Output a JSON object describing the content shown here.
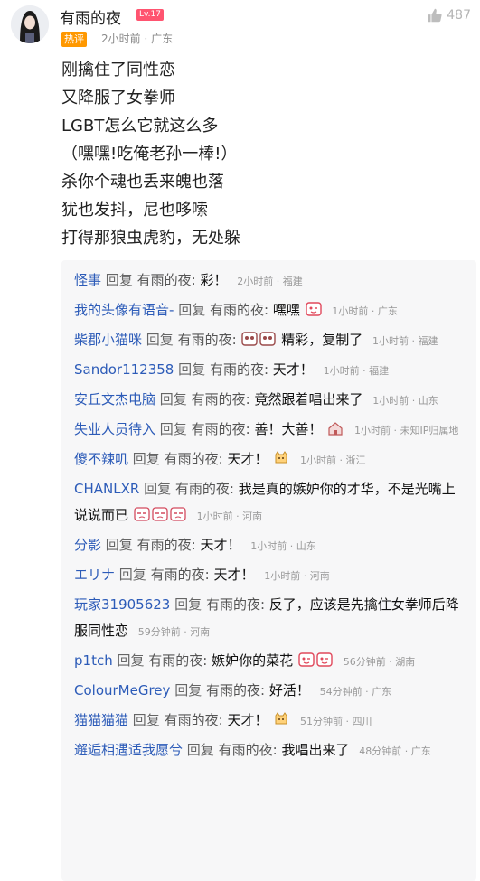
{
  "comment": {
    "username": "有雨的夜",
    "level_badge": "Lv.17",
    "like_count": "487",
    "hot_badge": "热评",
    "meta": "2小时前 · 广东",
    "content_lines": [
      "刚擒住了同性恋",
      "又降服了女拳师",
      "LGBT怎么它就这么多",
      "（嘿嘿!吃俺老孙一棒!）",
      "杀你个魂也丢来魄也落",
      "犹也发抖，尼也哆嗦",
      "打得那狼虫虎豹，无处躲"
    ]
  },
  "reply_word": "回复",
  "reply_target": "有雨的夜:",
  "replies": [
    {
      "nick": "怪事",
      "text": "彩！",
      "time": "2小时前 · 福建"
    },
    {
      "nick": "我的头像有语音-",
      "text": "嘿嘿",
      "time": "1小时前 · 广东"
    },
    {
      "nick": "柴郡小猫咪",
      "text": "精彩，复制了",
      "time": "1小时前 · 福建"
    },
    {
      "nick": "Sandor112358",
      "text": "天才！",
      "time": "1小时前 · 福建"
    },
    {
      "nick": "安丘文杰电脑",
      "text": "竟然跟着唱出来了",
      "time": "1小时前 · 山东"
    },
    {
      "nick": "失业人员待入",
      "text": "善！大善！",
      "time": "1小时前 · 未知IP归属地"
    },
    {
      "nick": "傻不辣叽",
      "text": "天才！",
      "time": "1小时前 · 浙江"
    },
    {
      "nick": "CHANLXR",
      "text": "我是真的嫉妒你的才华，不是光嘴上说说而已",
      "time": "1小时前 · 河南"
    },
    {
      "nick": "分影",
      "text": "天才！",
      "time": "1小时前 · 山东"
    },
    {
      "nick": "エリナ",
      "text": "天才！",
      "time": "1小时前 · 河南"
    },
    {
      "nick": "玩家31905623",
      "text": "反了，应该是先擒住女拳师后降服同性恋",
      "time": "59分钟前 · 河南"
    },
    {
      "nick": "p1tch",
      "text": "嫉妒你的菜花",
      "time": "56分钟前 · 湖南"
    },
    {
      "nick": "ColourMeGrey",
      "text": "好活！",
      "time": "54分钟前 · 广东"
    },
    {
      "nick": "猫猫猫猫",
      "text": "天才！",
      "time": "51分钟前 · 四川"
    },
    {
      "nick": "邂逅相遇适我愿兮",
      "text": "我唱出来了",
      "time": "48分钟前 · 广东"
    }
  ],
  "colors": {
    "nick": "#2c5bb8",
    "hot_badge": "#ff9800",
    "level_badge": "#ff5470",
    "reply_bg": "#f7f7f8"
  }
}
